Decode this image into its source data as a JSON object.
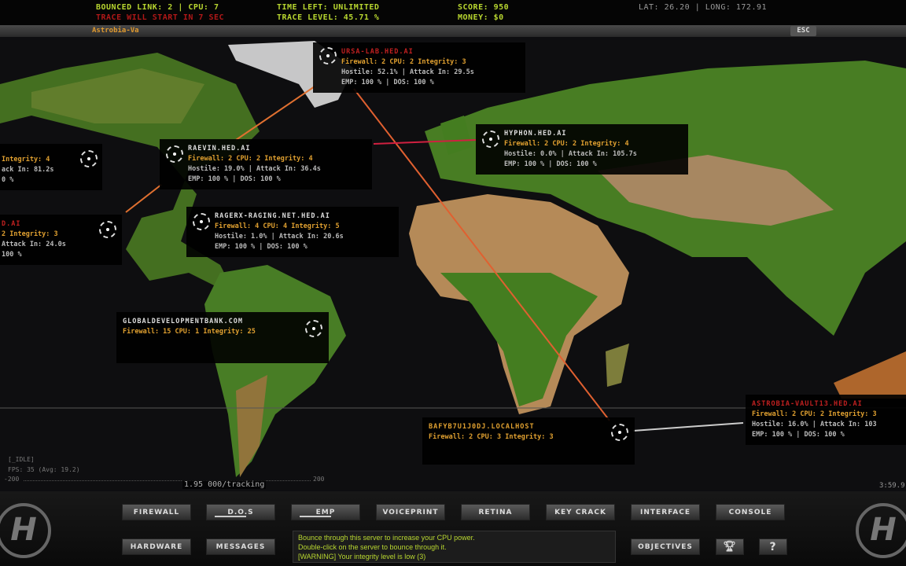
{
  "hud": {
    "bounced": "BOUNCED LINK: 2 | CPU: 7",
    "trace_warning": "TRACE WILL START IN 7 SEC",
    "time_left": "TIME LEFT: UNLIMITED",
    "trace_level": "TRACE LEVEL: 45.71 %",
    "score": "SCORE: 950",
    "money": "MONEY: $0",
    "coords": "LAT: 26.20 | LONG: 172.91"
  },
  "location": "Astrobia-Va",
  "esc_label": "ESC",
  "servers": [
    {
      "name": "URSA-LAB.HED.AI",
      "l1": "Firewall: 2 CPU: 2 Integrity: 3",
      "l2": "Hostile: 52.1% | Attack In: 29.5s",
      "l3": "EMP: 100 % | DOS: 100 %"
    },
    {
      "name": "HYPHON.HED.AI",
      "l1": "Firewall: 2 CPU: 2 Integrity: 4",
      "l2": "Hostile: 0.0% | Attack In: 105.7s",
      "l3": "EMP: 100 % | DOS: 100 %"
    },
    {
      "name": "RAEVIN.HED.AI",
      "l1": "Firewall: 2 CPU: 2 Integrity: 4",
      "l2": "Hostile: 19.0% | Attack In: 36.4s",
      "l3": "EMP: 100 % | DOS: 100 %"
    },
    {
      "name": "RAGERX-RAGING.NET.HED.AI",
      "l1": "Firewall: 4 CPU: 4 Integrity: 5",
      "l2": "Hostile: 1.0% | Attack In: 20.6s",
      "l3": "EMP: 100 % | DOS: 100 %"
    },
    {
      "name": "GLOBALDEVELOPMENTBANK.COM",
      "l1": "Firewall: 15 CPU: 1 Integrity: 25"
    },
    {
      "name": "BAFYB7U1J0DJ.LOCALHOST",
      "l1": "Firewall: 2 CPU: 3 Integrity: 3"
    },
    {
      "name": "ASTROBIA-VAULT13.HED.AI",
      "l1": "Firewall: 2 CPU: 2 Integrity: 3",
      "l2": "Hostile: 16.0% | Attack In: 103",
      "l3": "EMP: 100 % | DOS: 100 %"
    },
    {
      "l1": "Integrity: 4",
      "l2": "ack In: 81.2s",
      "l3": "0 %"
    },
    {
      "name": "D.AI",
      "l1": "2 Integrity: 3",
      "l2": "Attack In: 24.0s",
      "l3": "100 %"
    }
  ],
  "stats": {
    "idle": "[_IDLE]",
    "fps": "FPS: 35 (Avg: 19.2)",
    "axis_min": "-200",
    "axis_max": "200",
    "tracking": "1.95 000/tracking",
    "clock": "3:59.9"
  },
  "buttons": [
    "FIREWALL",
    "D.O.S",
    "EMP",
    "VOICEPRINT",
    "RETINA",
    "KEY CRACK",
    "INTERFACE",
    "CONSOLE"
  ],
  "buttons2": [
    "HARDWARE",
    "MESSAGES",
    "OBJECTIVES",
    "?"
  ],
  "messages": [
    "Bounce through this server to increase your CPU power.",
    "Double-click on the server to bounce through it.",
    "[WARNING] Your integrity level is low (3)"
  ],
  "colors": {
    "hud_green": "#b8d630",
    "warn_red": "#b01818",
    "server_orange": "#e0a030"
  }
}
